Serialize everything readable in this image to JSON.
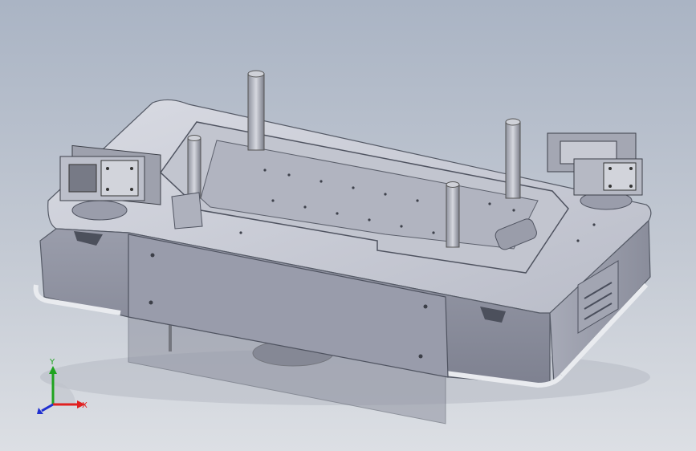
{
  "viewport": {
    "background_top": "#aab4c4",
    "background_bottom": "#dcdfe4"
  },
  "model": {
    "body_color": "#c9ccd6",
    "shadow_color": "#7c8090",
    "dark_color": "#4a4e5c"
  },
  "triad": {
    "x_label": "X",
    "y_label": "Y",
    "x_color": "#e02020",
    "y_color": "#1fa31f",
    "z_color": "#2030d0"
  }
}
